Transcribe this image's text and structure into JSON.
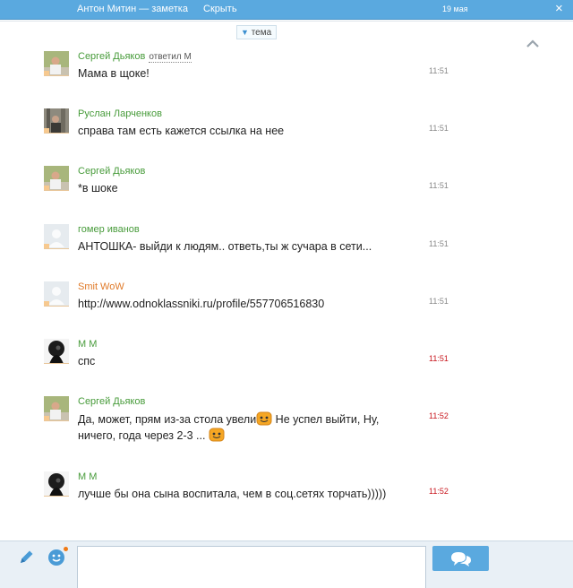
{
  "header": {
    "title": "Антон Митин — заметка",
    "hide_label": "Скрыть",
    "date": "19 мая"
  },
  "topic_label": "тема",
  "messages": [
    {
      "author": "Сергей Дьяков",
      "reply": "ответил М",
      "text": "Мама в щоке!",
      "time": "11:51",
      "time_color": "#888888",
      "avatar": "photo"
    },
    {
      "author": "Руслан Ларченков",
      "reply": "",
      "text": "справа там есть кажется ссылка на нее",
      "time": "11:51",
      "time_color": "#888888",
      "avatar": "photo"
    },
    {
      "author": "Сергей Дьяков",
      "reply": "",
      "text": "*в шоке",
      "time": "11:51",
      "time_color": "#888888",
      "avatar": "photo"
    },
    {
      "author": "гомер иванов",
      "reply": "",
      "text": "АНТОШКА- выйди к людям.. ответь,ты ж сучара в сети...",
      "time": "11:51",
      "time_color": "#888888",
      "avatar": "placeholder"
    },
    {
      "author": "Smit WoW",
      "reply": "",
      "text": "http://www.odnoklassniki.ru/profile/557706516830",
      "time": "11:51",
      "time_color": "#888888",
      "avatar": "placeholder"
    },
    {
      "author": "М М",
      "reply": "",
      "text": "спс",
      "time": "11:51",
      "time_color": "#c8161d",
      "avatar": "dark"
    },
    {
      "author": "Сергей Дьяков",
      "reply": "",
      "text_part1": "Да, может, прям из-за стола увели",
      "text_part2": " Не успел выйти, Ну, ничего, года через 2-3 ...",
      "time": "11:52",
      "time_color": "#c8161d",
      "avatar": "photo"
    },
    {
      "author": "М М",
      "reply": "",
      "text": "лучше бы она сына воспитала, чем в соц.сетях торчать)))))",
      "time": "11:52",
      "time_color": "#c8161d",
      "avatar": "dark"
    }
  ],
  "icons": {
    "collapse": "chevron-up-icon",
    "pencil": "pencil-icon",
    "emoticon": "smiley-icon",
    "send": "chat-bubbles-icon"
  },
  "colors": {
    "accent": "#5aa9df",
    "author_green": "#479b3a",
    "author_orange": "#e07a29",
    "time_red": "#c8161d",
    "notification": "#f07a16"
  },
  "input": {
    "value": "",
    "placeholder": ""
  }
}
